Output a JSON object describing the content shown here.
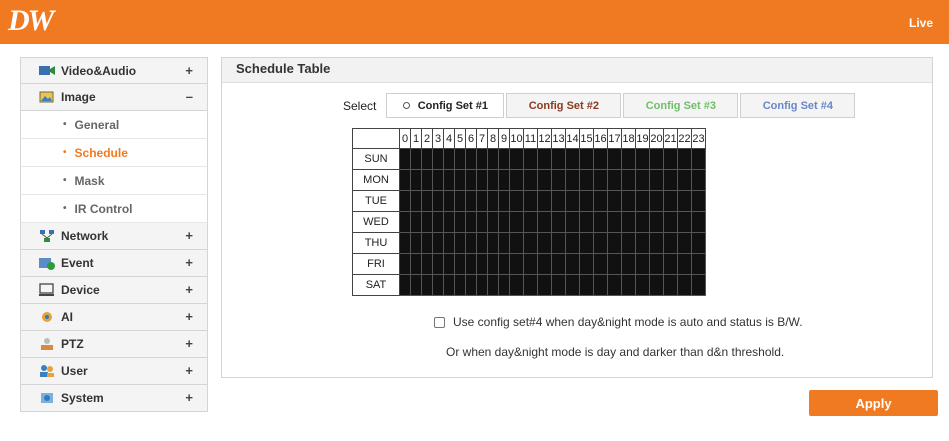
{
  "header": {
    "logo": "DW",
    "live_label": "Live"
  },
  "sidebar": {
    "items": [
      {
        "label": "Video&Audio",
        "sign": "+",
        "icon": "video-audio-icon"
      },
      {
        "label": "Image",
        "sign": "–",
        "icon": "image-icon",
        "expanded": true,
        "children": [
          {
            "label": "General"
          },
          {
            "label": "Schedule",
            "active": true
          },
          {
            "label": "Mask"
          },
          {
            "label": "IR Control"
          }
        ]
      },
      {
        "label": "Network",
        "sign": "+",
        "icon": "network-icon"
      },
      {
        "label": "Event",
        "sign": "+",
        "icon": "event-icon"
      },
      {
        "label": "Device",
        "sign": "+",
        "icon": "device-icon"
      },
      {
        "label": "AI",
        "sign": "+",
        "icon": "ai-icon"
      },
      {
        "label": "PTZ",
        "sign": "+",
        "icon": "ptz-icon"
      },
      {
        "label": "User",
        "sign": "+",
        "icon": "user-icon"
      },
      {
        "label": "System",
        "sign": "+",
        "icon": "system-icon"
      }
    ],
    "bullet": "•"
  },
  "panel": {
    "title": "Schedule Table",
    "select_label": "Select",
    "config_sets": [
      {
        "label": "Config Set #1",
        "color": "#222222",
        "selected": true
      },
      {
        "label": "Config Set #2",
        "color": "#8b3a1e"
      },
      {
        "label": "Config Set #3",
        "color": "#6fbf6a"
      },
      {
        "label": "Config Set #4",
        "color": "#6a86c9"
      }
    ],
    "hours": [
      "0",
      "1",
      "2",
      "3",
      "4",
      "5",
      "6",
      "7",
      "8",
      "9",
      "10",
      "11",
      "12",
      "13",
      "14",
      "15",
      "16",
      "17",
      "18",
      "19",
      "20",
      "21",
      "22",
      "23"
    ],
    "days": [
      "SUN",
      "MON",
      "TUE",
      "WED",
      "THU",
      "FRI",
      "SAT"
    ],
    "cell_fill_color": "#111111",
    "checkbox_label": "Use config set#4 when day&night mode is auto and status is B/W.",
    "checkbox_checked": false,
    "note": "Or when day&night mode is day and darker than d&n threshold."
  },
  "apply_label": "Apply",
  "colors": {
    "accent": "#f07a22"
  }
}
